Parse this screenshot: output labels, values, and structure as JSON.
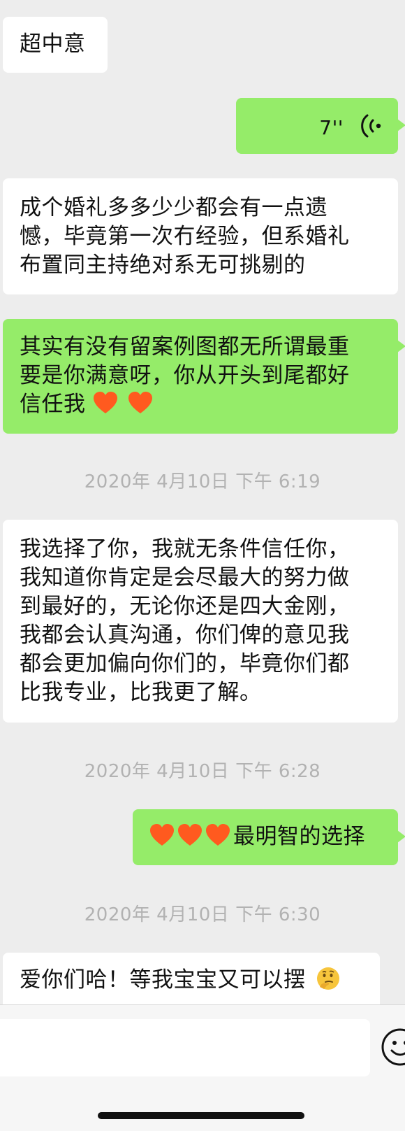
{
  "messages": {
    "m1": {
      "text": "超中意"
    },
    "m2": {
      "duration": "7''"
    },
    "m3": {
      "lines": [
        "成个婚礼多多少少都会有一点遗",
        "憾，毕竟第一次冇经验，但系婚礼",
        "布置同主持绝对系无可挑剔的"
      ]
    },
    "m4": {
      "lines": [
        "其实有没有留案例图都无所谓最重",
        "要是你满意呀，你从开头到尾都好",
        "信任我"
      ]
    },
    "m5": {
      "lines": [
        "我选择了你，我就无条件信任你，",
        "我知道你肯定是会尽最大的努力做",
        "到最好的，无论你还是四大金刚，",
        "我都会认真沟通，你们俾的意见我",
        "都会更加偏向你们的，毕竟你们都",
        "比我专业，比我更了解。"
      ]
    },
    "m6": {
      "text": "最明智的选择"
    },
    "m7": {
      "text": "爱你们哈！等我宝宝又可以摆"
    }
  },
  "timestamps": {
    "t1": "2020年 4月10日 下午 6:19",
    "t2": "2020年 4月10日 下午 6:28",
    "t3": "2020年 4月10日 下午 6:30"
  },
  "input": {
    "value": ""
  },
  "icons": {
    "voice": "voice-wave-icon",
    "heart": "orange-heart-emoji",
    "thinking": "thinking-face-emoji",
    "emoji_button": "smiley-face-icon"
  },
  "colors": {
    "background": "#ededed",
    "incoming_bubble": "#ffffff",
    "outgoing_bubble": "#95ec69",
    "timestamp": "#b2b2b2",
    "heart": "#ff5a1f"
  }
}
